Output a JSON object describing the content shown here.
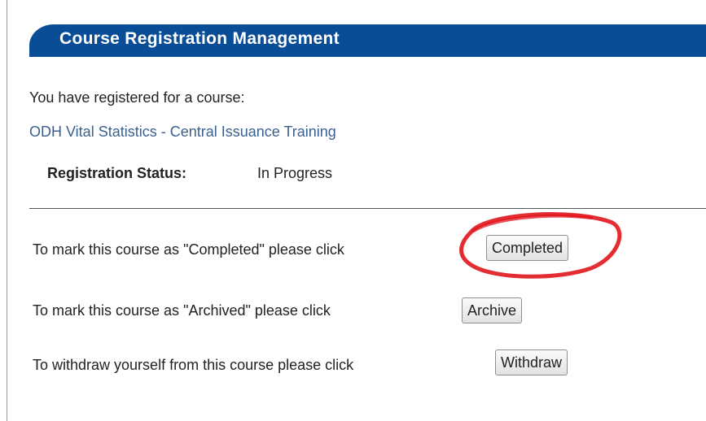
{
  "header": {
    "title": "Course Registration Management"
  },
  "registration": {
    "intro": "You have registered for a course:",
    "course_name": "ODH Vital Statistics - Central Issuance Training",
    "status_label": "Registration Status:",
    "status_value": "In Progress"
  },
  "actions": [
    {
      "text": "To mark this course as \"Completed\" please click",
      "button": "Completed"
    },
    {
      "text": "To mark this course as \"Archived\" please click",
      "button": "Archive"
    },
    {
      "text": "To withdraw yourself from this course please click",
      "button": "Withdraw"
    }
  ],
  "annotation": {
    "color": "#e0161c",
    "shape": "hand-drawn-ellipse"
  }
}
